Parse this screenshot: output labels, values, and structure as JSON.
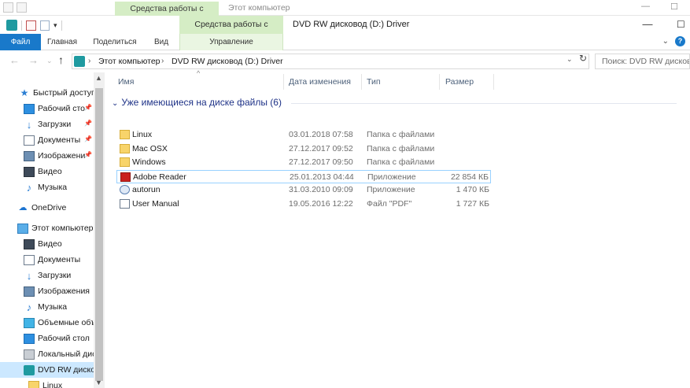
{
  "background_window": {
    "contextual_tab": "Средства работы с дисками",
    "title": "Этот компьютер",
    "minimize_glyph": "—",
    "maximize_glyph": "☐"
  },
  "window": {
    "contextual_tab": "Средства работы с дисками",
    "title": "DVD RW дисковод (D:) Driver",
    "minimize_glyph": "—",
    "maximize_glyph": "☐"
  },
  "ribbon": {
    "tabs": [
      "Файл",
      "Главная",
      "Поделиться",
      "Вид",
      "Управление"
    ]
  },
  "address": {
    "breadcrumbs": [
      "Этот компьютер",
      "DVD RW дисковод (D:) Driver"
    ],
    "search_placeholder": "Поиск: DVD RW дисковод (D:) Driver"
  },
  "nav_pane": {
    "items": [
      {
        "label": "Быстрый доступ",
        "icon": "star-icon",
        "pinned": false,
        "selected": false
      },
      {
        "label": "Рабочий сто",
        "icon": "desktop-icon",
        "pinned": true,
        "selected": false
      },
      {
        "label": "Загрузки",
        "icon": "download-icon",
        "pinned": true,
        "selected": false
      },
      {
        "label": "Документы",
        "icon": "documents-icon",
        "pinned": true,
        "selected": false
      },
      {
        "label": "Изображени",
        "icon": "pictures-icon",
        "pinned": true,
        "selected": false
      },
      {
        "label": "Видео",
        "icon": "video-icon",
        "pinned": false,
        "selected": false
      },
      {
        "label": "Музыка",
        "icon": "music-icon",
        "pinned": false,
        "selected": false
      },
      {
        "label": "OneDrive",
        "icon": "cloud-icon",
        "pinned": false,
        "selected": false
      },
      {
        "label": "Этот компьютер",
        "icon": "computer-icon",
        "pinned": false,
        "selected": false
      },
      {
        "label": "Видео",
        "icon": "video-icon",
        "pinned": false,
        "selected": false
      },
      {
        "label": "Документы",
        "icon": "documents-icon",
        "pinned": false,
        "selected": false
      },
      {
        "label": "Загрузки",
        "icon": "download-icon",
        "pinned": false,
        "selected": false
      },
      {
        "label": "Изображения",
        "icon": "pictures-icon",
        "pinned": false,
        "selected": false
      },
      {
        "label": "Музыка",
        "icon": "music-icon",
        "pinned": false,
        "selected": false
      },
      {
        "label": "Объемные объ",
        "icon": "3d-objects-icon",
        "pinned": false,
        "selected": false
      },
      {
        "label": "Рабочий стол",
        "icon": "desktop-icon",
        "pinned": false,
        "selected": false
      },
      {
        "label": "Локальный дис",
        "icon": "hard-drive-icon",
        "pinned": false,
        "selected": false
      },
      {
        "label": "DVD RW дисков",
        "icon": "dvd-drive-icon",
        "pinned": false,
        "selected": true
      },
      {
        "label": "Linux",
        "icon": "folder-icon",
        "pinned": false,
        "selected": false
      }
    ]
  },
  "columns": [
    "Имя",
    "Дата изменения",
    "Тип",
    "Размер"
  ],
  "group": {
    "label": "Уже имеющиеся на диске файлы (6)"
  },
  "files": [
    {
      "name": "Linux",
      "date": "03.01.2018 07:58",
      "type": "Папка с файлами",
      "size": "",
      "icon": "folder-icon"
    },
    {
      "name": "Mac OSX",
      "date": "27.12.2017 09:52",
      "type": "Папка с файлами",
      "size": "",
      "icon": "folder-icon"
    },
    {
      "name": "Windows",
      "date": "27.12.2017 09:50",
      "type": "Папка с файлами",
      "size": "",
      "icon": "folder-icon"
    },
    {
      "name": "Adobe Reader",
      "date": "25.01.2013 04:44",
      "type": "Приложение",
      "size": "22 854 КБ",
      "icon": "adobe-reader-icon"
    },
    {
      "name": "autorun",
      "date": "31.03.2010 09:09",
      "type": "Приложение",
      "size": "1 470 КБ",
      "icon": "setup-app-icon"
    },
    {
      "name": "User Manual",
      "date": "19.05.2016 12:22",
      "type": "Файл \"PDF\"",
      "size": "1 727 КБ",
      "icon": "pdf-file-icon"
    }
  ],
  "colors": {
    "file_tab": "#1979ca",
    "contextual_tab": "#d5edc5",
    "selected_nav": "#cce8ff",
    "group_header": "#1e3287"
  }
}
